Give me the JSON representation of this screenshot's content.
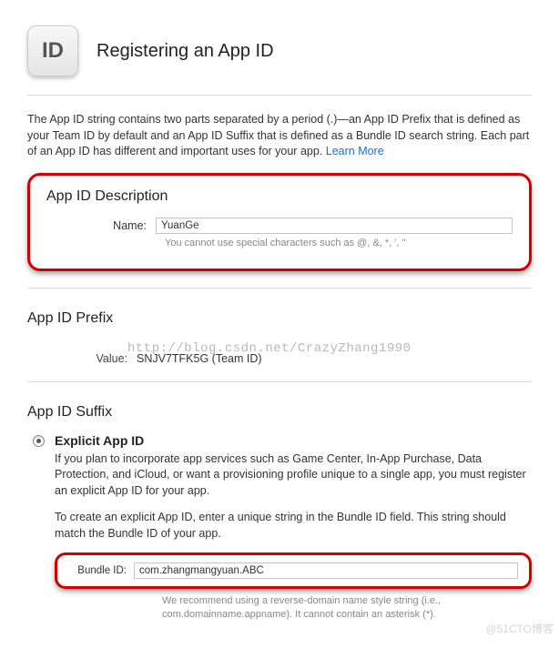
{
  "header": {
    "icon_label": "ID",
    "title": "Registering an App ID"
  },
  "intro": {
    "text": "The App ID string contains two parts separated by a period (.)—an App ID Prefix that is defined as your Team ID by default and an App ID Suffix that is defined as a Bundle ID search string. Each part of an App ID has different and important uses for your app. ",
    "learn_more": "Learn More"
  },
  "description": {
    "heading": "App ID Description",
    "name_label": "Name:",
    "name_value": "YuanGe",
    "name_hint": "You cannot use special characters such as @, &, *, ', \""
  },
  "watermark": "http://blog.csdn.net/CrazyZhang1990",
  "prefix": {
    "heading": "App ID Prefix",
    "value_label": "Value:",
    "value_text": "SNJV7TFK5G (Team ID)"
  },
  "suffix": {
    "heading": "App ID Suffix",
    "explicit": {
      "title": "Explicit App ID",
      "p1": "If you plan to incorporate app services such as Game Center, In-App Purchase, Data Protection, and iCloud, or want a provisioning profile unique to a single app, you must register an explicit App ID for your app.",
      "p2": "To create an explicit App ID, enter a unique string in the Bundle ID field. This string should match the Bundle ID of your app.",
      "bundle_label": "Bundle ID:",
      "bundle_value": "com.zhangmangyuan.ABC",
      "bundle_hint": "We recommend using a reverse-domain name style string (i.e., com.domainname.appname). It cannot contain an asterisk (*)."
    }
  },
  "footer_watermark": "@51CTO博客"
}
